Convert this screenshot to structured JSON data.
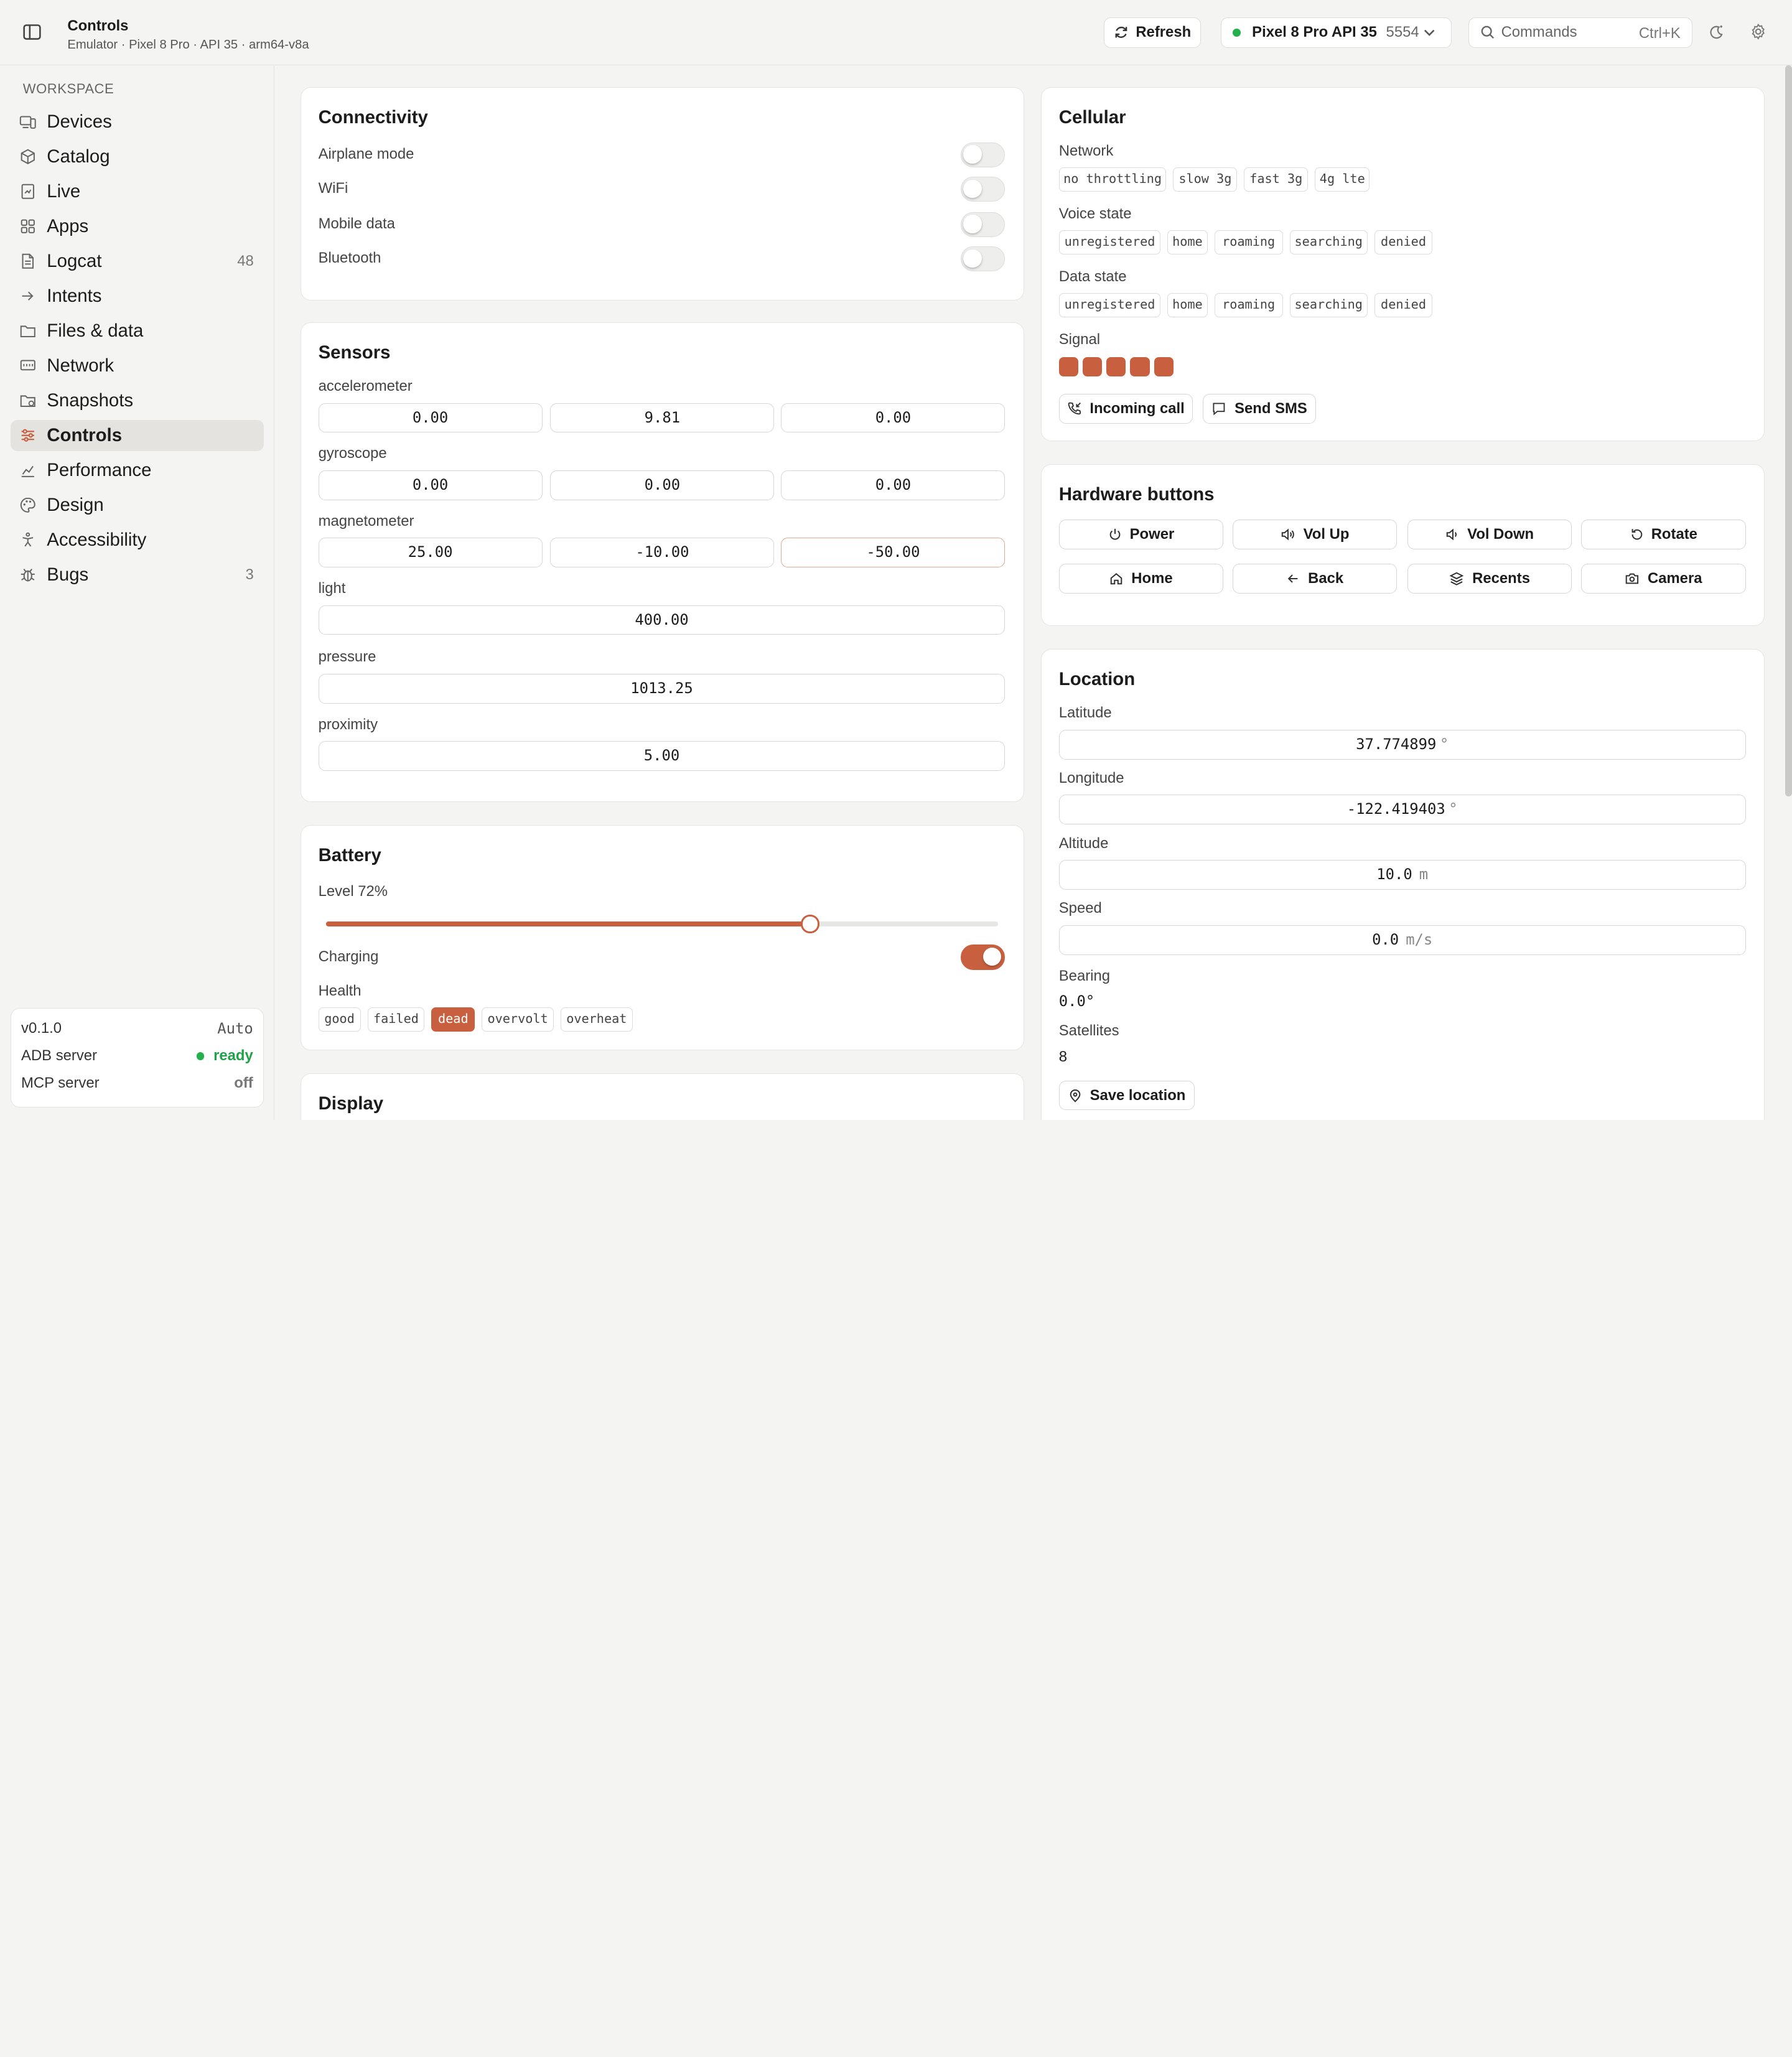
{
  "header": {
    "title": "Controls",
    "subtitle": "Emulator · Pixel 8 Pro · API 35 · arm64-v8a",
    "refresh_label": "Refresh",
    "device_name": "Pixel 8 Pro API 35",
    "device_port": "5554",
    "search_placeholder": "Commands",
    "search_shortcut": "Ctrl+K"
  },
  "sidebar": {
    "section_label": "WORKSPACE",
    "items": [
      {
        "label": "Devices",
        "icon": "devices-icon"
      },
      {
        "label": "Catalog",
        "icon": "box-icon"
      },
      {
        "label": "Live",
        "icon": "live-icon"
      },
      {
        "label": "Apps",
        "icon": "grid-icon"
      },
      {
        "label": "Logcat",
        "icon": "file-icon",
        "count": "48"
      },
      {
        "label": "Intents",
        "icon": "arrow-right-icon"
      },
      {
        "label": "Files & data",
        "icon": "folder-icon"
      },
      {
        "label": "Network",
        "icon": "network-icon"
      },
      {
        "label": "Snapshots",
        "icon": "folder-clock-icon"
      },
      {
        "label": "Controls",
        "icon": "sliders-icon",
        "active": true
      },
      {
        "label": "Performance",
        "icon": "chart-icon"
      },
      {
        "label": "Design",
        "icon": "palette-icon"
      },
      {
        "label": "Accessibility",
        "icon": "accessibility-icon"
      },
      {
        "label": "Bugs",
        "icon": "bug-icon",
        "count": "3"
      }
    ],
    "status": {
      "version": "v0.1.0",
      "mode": "Auto",
      "adb_label": "ADB server",
      "adb_value": "ready",
      "mcp_label": "MCP server",
      "mcp_value": "off"
    }
  },
  "connectivity": {
    "title": "Connectivity",
    "airplane": "Airplane mode",
    "wifi": "WiFi",
    "mobile": "Mobile data",
    "bluetooth": "Bluetooth"
  },
  "sensors": {
    "title": "Sensors",
    "accelerometer": {
      "label": "accelerometer",
      "x": "0.00",
      "y": "9.81",
      "z": "0.00"
    },
    "gyroscope": {
      "label": "gyroscope",
      "x": "0.00",
      "y": "0.00",
      "z": "0.00"
    },
    "magnetometer": {
      "label": "magnetometer",
      "x": "25.00",
      "y": "-10.00",
      "z": "-50.00"
    },
    "light": {
      "label": "light",
      "value": "400.00"
    },
    "pressure": {
      "label": "pressure",
      "value": "1013.25"
    },
    "proximity": {
      "label": "proximity",
      "value": "5.00"
    }
  },
  "battery": {
    "title": "Battery",
    "level_label": "Level 72%",
    "level": 0.72,
    "charging_label": "Charging",
    "charging": true,
    "health_label": "Health",
    "health_options": [
      "good",
      "failed",
      "dead",
      "overvolt",
      "overheat"
    ],
    "health_selected": "dead"
  },
  "display": {
    "title": "Display"
  },
  "cellular": {
    "title": "Cellular",
    "network_label": "Network",
    "network_options": [
      "no throttling",
      "slow 3g",
      "fast 3g",
      "4g lte"
    ],
    "voice_label": "Voice state",
    "voice_options": [
      "unregistered",
      "home",
      "roaming",
      "searching",
      "denied"
    ],
    "data_label": "Data state",
    "data_options": [
      "unregistered",
      "home",
      "roaming",
      "searching",
      "denied"
    ],
    "signal_label": "Signal",
    "signal_level": 5,
    "incoming_call": "Incoming call",
    "send_sms": "Send SMS"
  },
  "hardware": {
    "title": "Hardware buttons",
    "power": "Power",
    "vol_up": "Vol Up",
    "vol_down": "Vol Down",
    "rotate": "Rotate",
    "home": "Home",
    "back": "Back",
    "recents": "Recents",
    "camera": "Camera"
  },
  "location": {
    "title": "Location",
    "latitude_label": "Latitude",
    "latitude": "37.774899",
    "latitude_unit": "°",
    "longitude_label": "Longitude",
    "longitude": "-122.419403",
    "longitude_unit": "°",
    "altitude_label": "Altitude",
    "altitude": "10.0",
    "altitude_unit": "m",
    "speed_label": "Speed",
    "speed": "0.0",
    "speed_unit": "m/s",
    "bearing_label": "Bearing",
    "bearing": "0.0°",
    "satellites_label": "Satellites",
    "satellites": "8",
    "save_label": "Save location"
  },
  "colors": {
    "accent": "#c8603f",
    "ready": "#22a04a"
  }
}
